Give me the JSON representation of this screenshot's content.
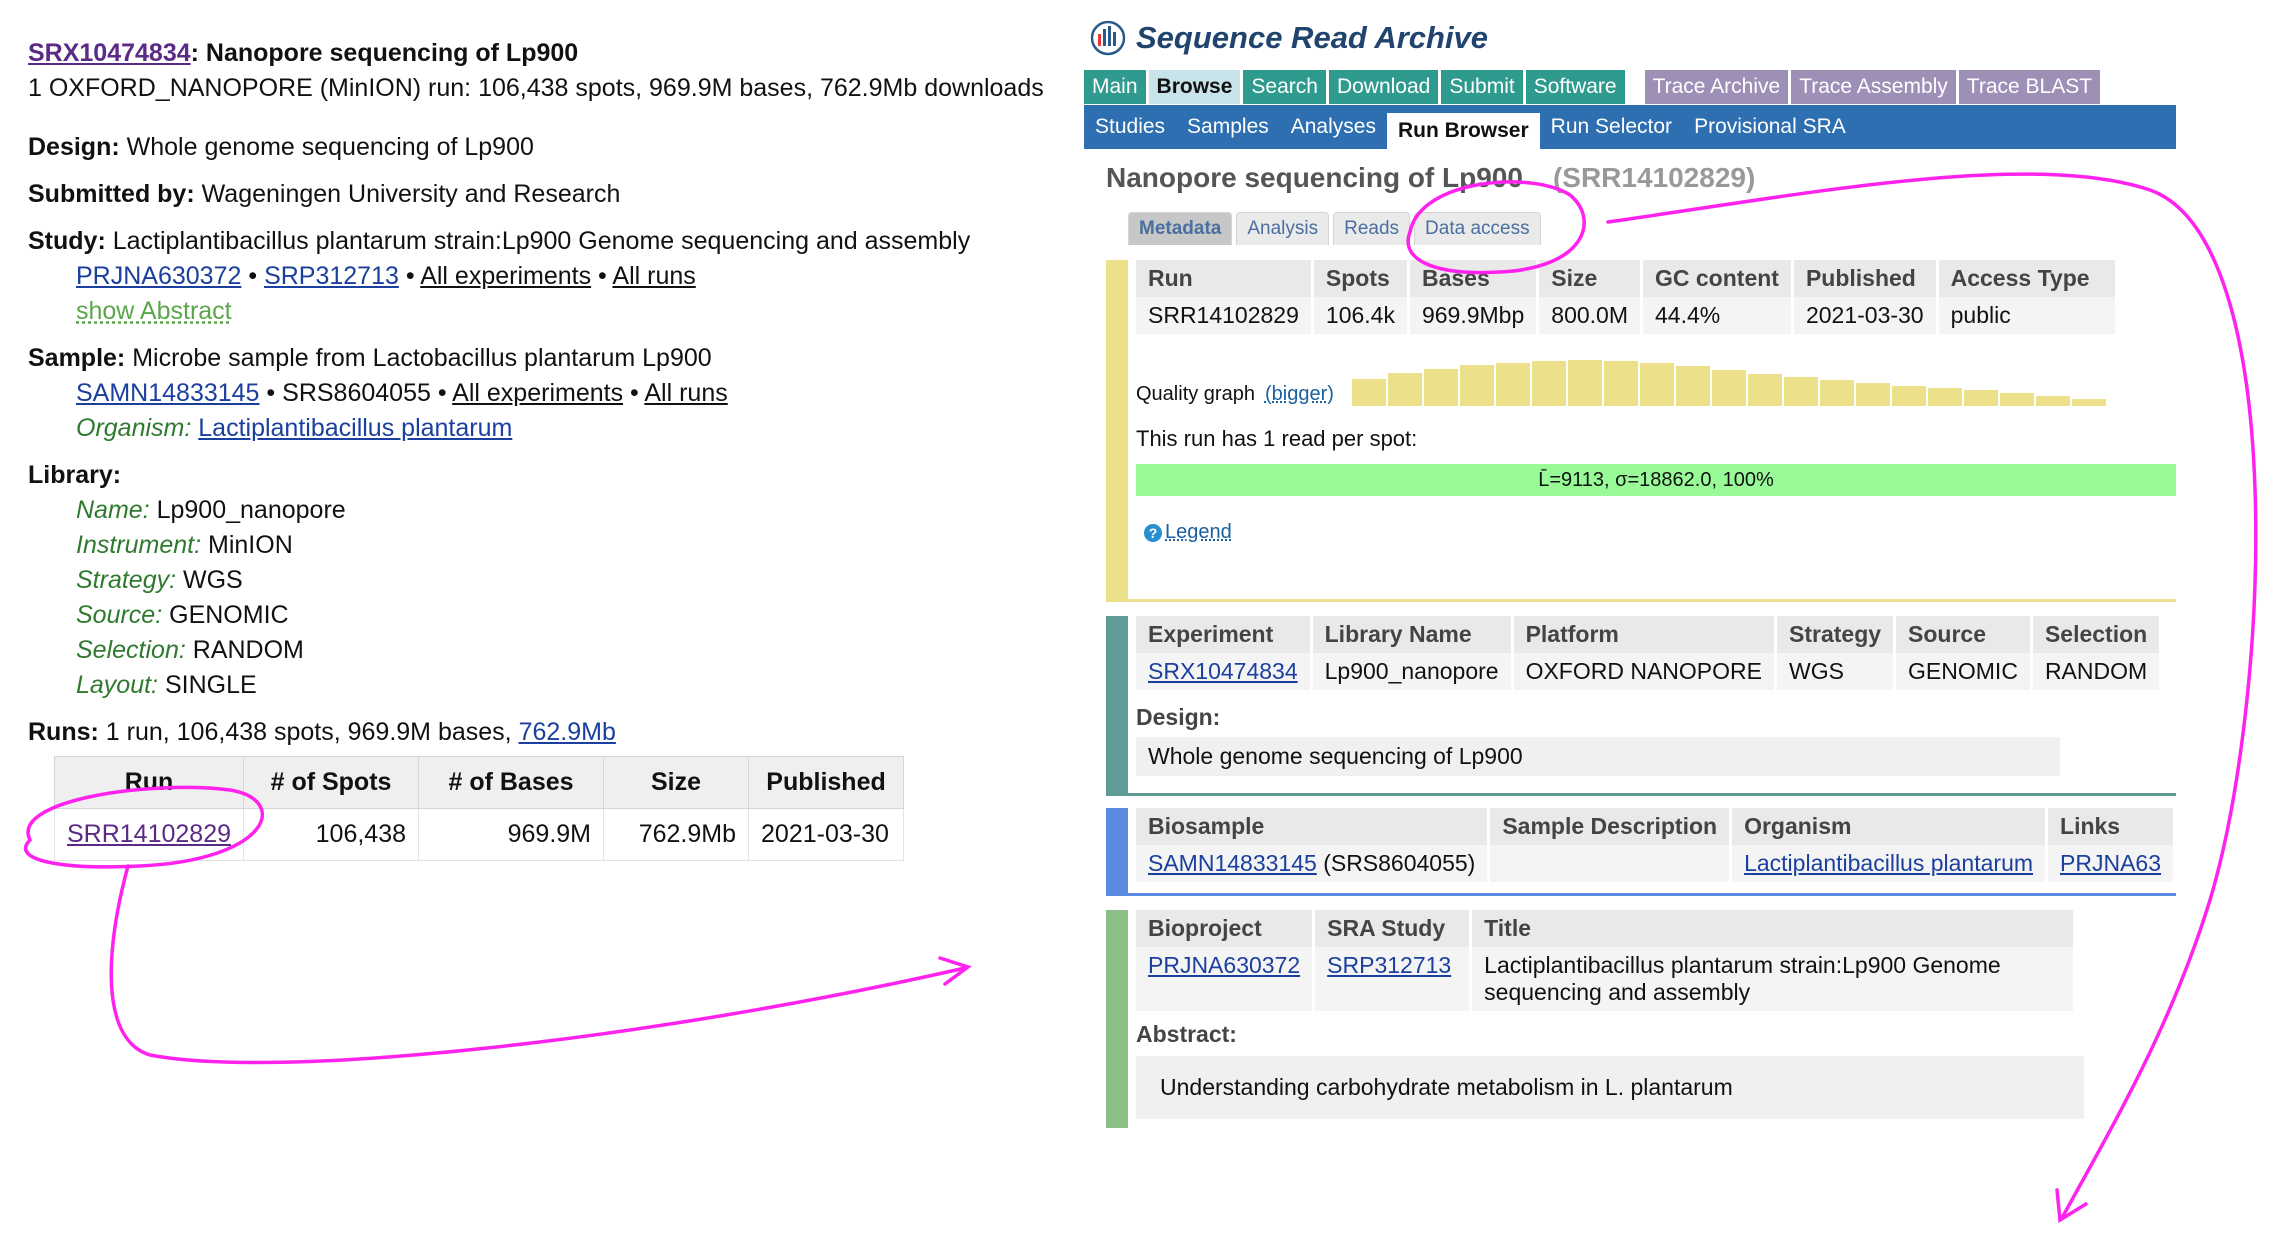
{
  "left": {
    "exp_id": "SRX10474834",
    "exp_title": ": Nanopore sequencing of Lp900",
    "exp_summary": "1 OXFORD_NANOPORE (MinION) run: 106,438 spots, 969.9M bases, 762.9Mb downloads",
    "design_label": "Design:",
    "design_value": "Whole genome sequencing of Lp900",
    "submitted_label": "Submitted by:",
    "submitted_value": "Wageningen University and Research",
    "study_label": "Study:",
    "study_value": "Lactiplantibacillus plantarum strain:Lp900 Genome sequencing and assembly",
    "study_bioproject": "PRJNA630372",
    "study_srp": "SRP312713",
    "all_experiments": "All experiments",
    "all_runs": "All runs",
    "bullet": "•",
    "show_abstract": "show Abstract",
    "sample_label": "Sample:",
    "sample_value": "Microbe sample from Lactobacillus plantarum Lp900",
    "sample_biosample": "SAMN14833145",
    "sample_srs": "SRS8604055",
    "organism_label": "Organism:",
    "organism_value": "Lactiplantibacillus plantarum",
    "library_label": "Library:",
    "lib_name_label": "Name:",
    "lib_name": "Lp900_nanopore",
    "lib_instrument_label": "Instrument:",
    "lib_instrument": "MinION",
    "lib_strategy_label": "Strategy:",
    "lib_strategy": "WGS",
    "lib_source_label": "Source:",
    "lib_source": "GENOMIC",
    "lib_selection_label": "Selection:",
    "lib_selection": "RANDOM",
    "lib_layout_label": "Layout:",
    "lib_layout": "SINGLE",
    "runs_label": "Runs:",
    "runs_value": "1 run, 106,438 spots, 969.9M bases,",
    "runs_link": "762.9Mb",
    "runs_table": {
      "headers": [
        "Run",
        "# of Spots",
        "# of Bases",
        "Size",
        "Published"
      ],
      "row": [
        "SRR14102829",
        "106,438",
        "969.9M",
        "762.9Mb",
        "2021-03-30"
      ]
    }
  },
  "right": {
    "brand": "Sequence Read Archive",
    "nav1": [
      "Main",
      "Browse",
      "Search",
      "Download",
      "Submit",
      "Software"
    ],
    "nav1_grey": [
      "Trace Archive",
      "Trace Assembly",
      "Trace BLAST"
    ],
    "nav2": [
      "Studies",
      "Samples",
      "Analyses",
      "Run Browser",
      "Run Selector",
      "Provisional SRA"
    ],
    "title": "Nanopore sequencing of Lp900",
    "accession": "(SRR14102829)",
    "metatabs": [
      "Metadata",
      "Analysis",
      "Reads",
      "Data access"
    ],
    "run_table": {
      "headers": [
        "Run",
        "Spots",
        "Bases",
        "Size",
        "GC content",
        "Published",
        "Access Type"
      ],
      "row": [
        "SRR14102829",
        "106.4k",
        "969.9Mbp",
        "800.0M",
        "44.4%",
        "2021-03-30",
        "public"
      ]
    },
    "quality_label": "Quality graph",
    "quality_link": "(bigger)",
    "quality_bars": [
      0.45,
      0.55,
      0.62,
      0.68,
      0.72,
      0.75,
      0.76,
      0.75,
      0.72,
      0.66,
      0.6,
      0.54,
      0.48,
      0.43,
      0.38,
      0.34,
      0.3,
      0.26,
      0.22,
      0.17,
      0.12
    ],
    "reads_text": "This run has 1 read per spot:",
    "read_bar": "L̄=9113, σ=18862.0, 100%",
    "legend": "Legend",
    "exp_table": {
      "headers": [
        "Experiment",
        "Library Name",
        "Platform",
        "Strategy",
        "Source",
        "Selection"
      ],
      "row": [
        "SRX10474834",
        "Lp900_nanopore",
        "OXFORD NANOPORE",
        "WGS",
        "GENOMIC",
        "RANDOM"
      ]
    },
    "design_label": "Design:",
    "design_value": "Whole genome sequencing of Lp900",
    "bio_table": {
      "headers": [
        "Biosample",
        "Sample Description",
        "Organism",
        "Links"
      ],
      "biosample": "SAMN14833145",
      "srs": "(SRS8604055)",
      "organism": "Lactiplantibacillus plantarum",
      "links": "PRJNA63"
    },
    "proj_table": {
      "headers": [
        "Bioproject",
        "SRA Study",
        "Title"
      ],
      "bioproject": "PRJNA630372",
      "study": "SRP312713",
      "title": "Lactiplantibacillus plantarum strain:Lp900 Genome sequencing and assembly"
    },
    "abstract_label": "Abstract:",
    "abstract_value": "Understanding carbohydrate metabolism in L. plantarum"
  },
  "colors": {
    "annotation": "#ff22ee",
    "nav_teal": "#2e9b8e",
    "nav_blue": "#2d6fb0",
    "bar_yellow": "#ece08a",
    "bar_teal": "#5f9c97",
    "bar_blue": "#5b8be0",
    "bar_green": "#8cbf86"
  }
}
